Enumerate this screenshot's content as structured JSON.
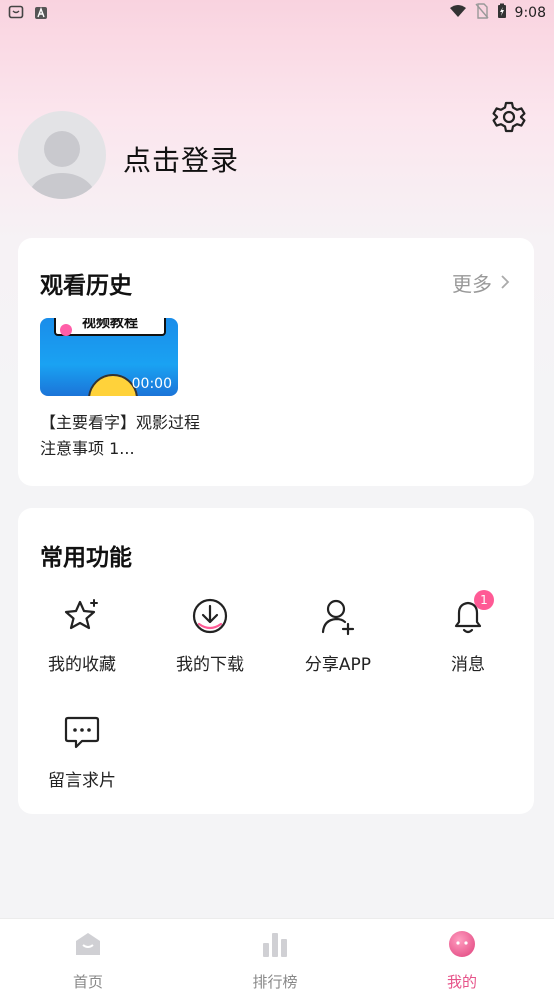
{
  "status_bar": {
    "time": "9:08",
    "left_icons": [
      "app-notification-icon",
      "font-a-icon"
    ],
    "right_icons": [
      "wifi-icon",
      "no-sim-icon",
      "battery-charging-icon"
    ]
  },
  "profile": {
    "login_text": "点击登录",
    "avatar_icon": "default-avatar-icon",
    "settings_icon": "gear-icon"
  },
  "history": {
    "title": "观看历史",
    "more_label": "更多",
    "items": [
      {
        "thumb_text": "视频教程",
        "duration": "00:00",
        "title": "【主要看字】观影过程注意事项 1..."
      }
    ]
  },
  "functions": {
    "title": "常用功能",
    "items": [
      {
        "label": "我的收藏",
        "icon": "star-sparkle-icon"
      },
      {
        "label": "我的下载",
        "icon": "download-circle-icon"
      },
      {
        "label": "分享APP",
        "icon": "add-user-icon"
      },
      {
        "label": "消息",
        "icon": "bell-icon",
        "badge": "1"
      },
      {
        "label": "留言求片",
        "icon": "chat-bubble-icon"
      }
    ]
  },
  "tabbar": {
    "tabs": [
      {
        "label": "首页",
        "icon": "home-icon"
      },
      {
        "label": "排行榜",
        "icon": "ranking-bars-icon"
      },
      {
        "label": "我的",
        "icon": "profile-face-icon",
        "active": true
      }
    ]
  },
  "colors": {
    "accent": "#e6548a",
    "badge": "#ff5a95",
    "header_pink": "#f9d3df",
    "page_bg": "#f4f4f6"
  }
}
